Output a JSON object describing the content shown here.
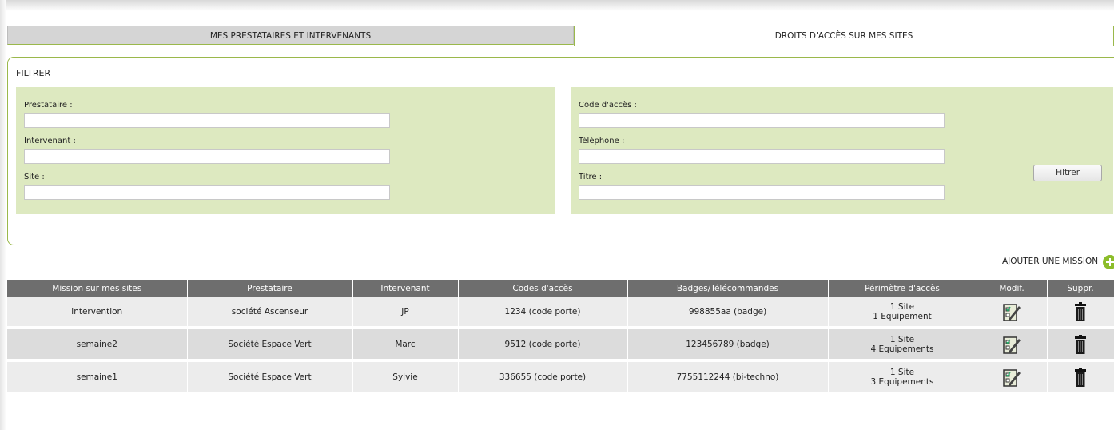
{
  "tabs": [
    {
      "label": "MES PRESTATAIRES ET INTERVENANTS",
      "active": false
    },
    {
      "label": "DROITS D'ACCÈS SUR MES SITES",
      "active": true
    }
  ],
  "filter": {
    "title": "FILTRER",
    "left_fields": [
      {
        "label": "Prestataire :",
        "value": ""
      },
      {
        "label": "Intervenant :",
        "value": ""
      },
      {
        "label": "Site :",
        "value": ""
      }
    ],
    "right_fields": [
      {
        "label": "Code d'accès :",
        "value": ""
      },
      {
        "label": "Téléphone :",
        "value": ""
      },
      {
        "label": "Titre :",
        "value": ""
      }
    ],
    "button_label": "Filtrer"
  },
  "add_mission_label": "AJOUTER UNE MISSION",
  "table": {
    "headers": [
      "Mission sur mes sites",
      "Prestataire",
      "Intervenant",
      "Codes d'accès",
      "Badges/Télécommandes",
      "Périmètre d'accès",
      "Modif.",
      "Suppr."
    ],
    "rows": [
      {
        "mission": "intervention",
        "prestataire": "société Ascenseur",
        "intervenant": "JP",
        "codes": "1234 (code porte)",
        "badges": "998855aa (badge)",
        "perimetre_sites": "1 Site",
        "perimetre_equip": "1 Equipement"
      },
      {
        "mission": "semaine2",
        "prestataire": "Société Espace Vert",
        "intervenant": "Marc",
        "codes": "9512 (code porte)",
        "badges": "123456789 (badge)",
        "perimetre_sites": "1 Site",
        "perimetre_equip": "4 Equipements"
      },
      {
        "mission": "semaine1",
        "prestataire": "Société Espace Vert",
        "intervenant": "Sylvie",
        "codes": "336655 (code porte)",
        "badges": "7755112244 (bi-techno)",
        "perimetre_sites": "1 Site",
        "perimetre_equip": "3 Equipements"
      }
    ]
  },
  "icons": {
    "edit": "edit-checklist-icon",
    "delete": "trash-icon",
    "add": "plus-circle-icon"
  },
  "colors": {
    "accent_green": "#9ab84b",
    "filter_bg": "#dde9c0",
    "header_bg": "#6e6e6e"
  }
}
